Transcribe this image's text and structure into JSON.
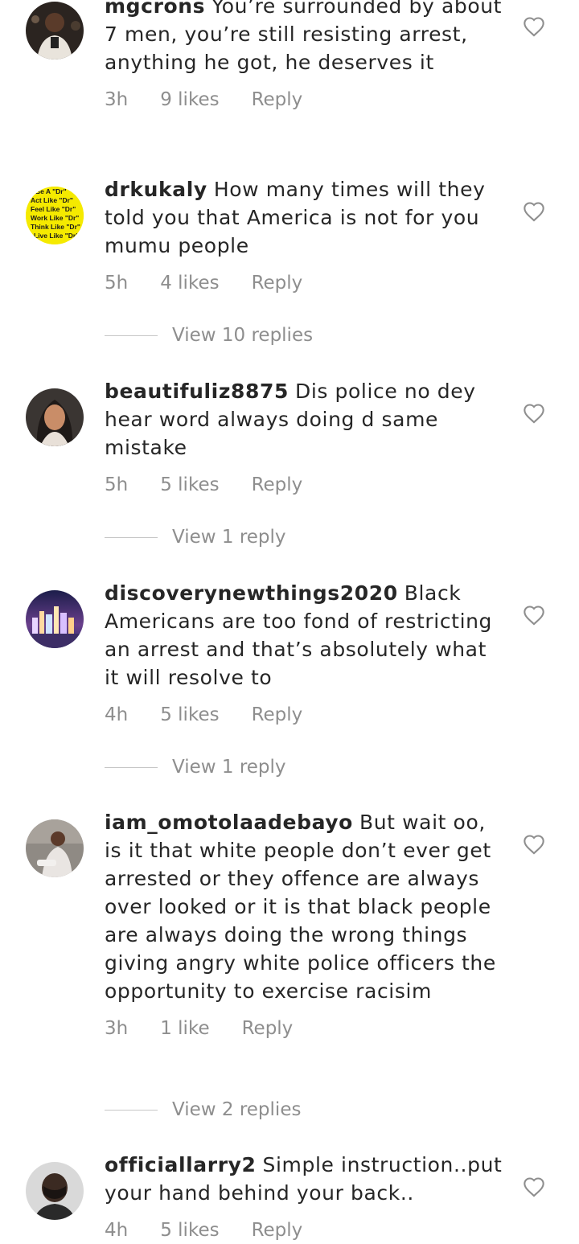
{
  "comments": [
    {
      "username": "mgcrons",
      "text": "You’re surrounded by about 7 men, you’re still resisting arrest, anything he got, he deserves it",
      "time": "3h",
      "likes": "9 likes",
      "reply": "Reply",
      "view_replies": ""
    },
    {
      "username": "drkukaly",
      "text": "How many times will they told you that America is not for you mumu people",
      "time": "5h",
      "likes": "4 likes",
      "reply": "Reply",
      "view_replies": "View 10 replies"
    },
    {
      "username": "beautifuliz8875",
      "text": "Dis police no dey hear word always doing d same mistake",
      "time": "5h",
      "likes": "5 likes",
      "reply": "Reply",
      "view_replies": "View 1 reply"
    },
    {
      "username": "discoverynewthings2020",
      "text": "Black Americans are too fond of restricting an arrest and that’s absolutely what it will resolve to",
      "time": "4h",
      "likes": "5 likes",
      "reply": "Reply",
      "view_replies": "View 1 reply"
    },
    {
      "username": "iam_omotolaadebayo",
      "text": "But wait oo, is it that white people don’t ever get arrested or they offence are always over looked or it is that black people are always doing the wrong things giving angry white police officers the opportunity to exercise racisim",
      "time": "3h",
      "likes": "1 like",
      "reply": "Reply",
      "view_replies": "View 2 replies"
    },
    {
      "username": "officiallarry2",
      "text": "Simple instruction..put your hand behind your back..",
      "time": "4h",
      "likes": "5 likes",
      "reply": "Reply",
      "view_replies": ""
    }
  ],
  "avatar2_lines": [
    "Be A \"Dr\"",
    "Act Like \"Dr\"",
    "Feel Like \"Dr\"",
    "Work Like \"Dr\"",
    "Think Like \"Dr\"",
    "Live Like \"Dr\""
  ],
  "colors": {
    "text": "#262626",
    "muted": "#8e8e8e",
    "avatar2_bg": "#f5ea00"
  }
}
